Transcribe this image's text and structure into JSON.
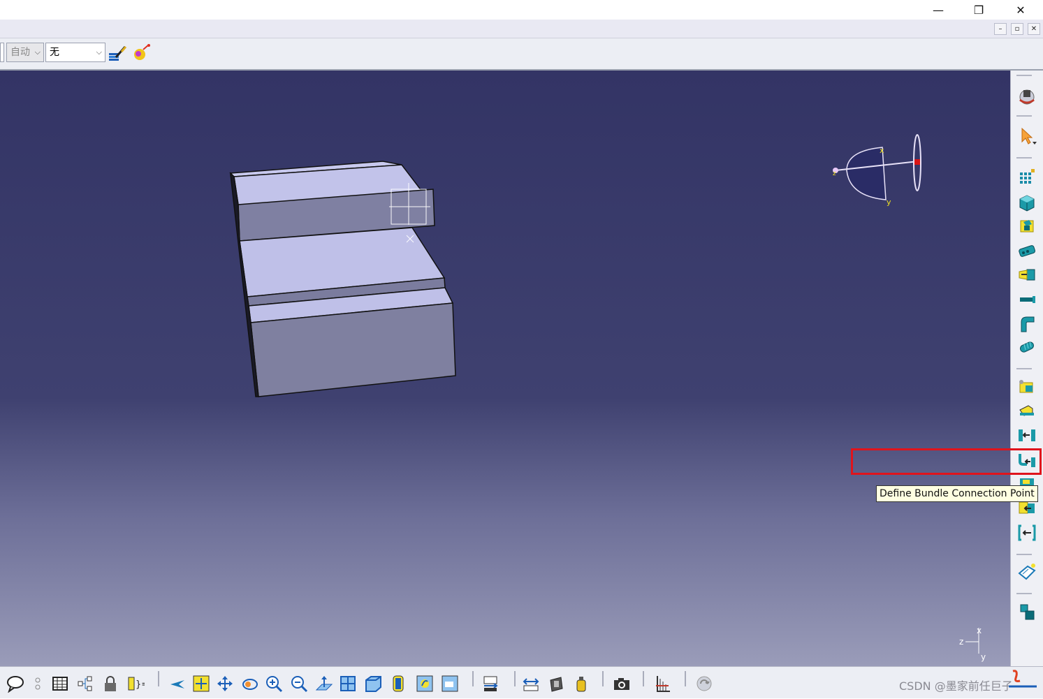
{
  "window": {
    "minimize_glyph": "—",
    "restore_glyph": "❐",
    "close_glyph": "✕",
    "mdi_minimize_glyph": "–",
    "mdi_restore_glyph": "▫",
    "mdi_close_glyph": "✕"
  },
  "toolbar": {
    "combo_layer": "自动",
    "combo_filter": "无",
    "icons": [
      "paintbrush-icon",
      "properties-painter-icon"
    ]
  },
  "tooltip": {
    "text": "Define Bundle Connection Point"
  },
  "axis_labels": {
    "compass_x": "x",
    "compass_y": "y",
    "compass_z": "z",
    "triad_x": "x",
    "triad_y": "y",
    "triad_z": "z"
  },
  "right_toolbar": {
    "icons": [
      "workbench-electrical-icon",
      "select-cursor-icon",
      "grid-icon",
      "electrical-box-icon",
      "device-icon",
      "connector-icon",
      "back-shell-icon",
      "bundle-segment-icon",
      "bent-pipe-icon",
      "cylinder-shell-icon",
      "define-cavity-icon",
      "define-connector-icon",
      "define-connection-point-icon",
      "define-bundle-connection-point-icon",
      "define-mounting-point-icon",
      "define-part-connection-icon",
      "define-internal-connection-icon",
      "part-properties-icon",
      "assembly-constraint-icon"
    ]
  },
  "bottom_toolbar": {
    "icons": [
      "speech-bubble-icon",
      "hole-icon",
      "table-icon",
      "tree-icon",
      "lock-icon",
      "formula-icon",
      "fly-mode-icon",
      "fit-all-icon",
      "pan-icon",
      "rotate-icon",
      "zoom-in-icon",
      "zoom-out-icon",
      "normal-view-icon",
      "multi-view-icon",
      "iso-view-icon",
      "shading-icon",
      "hide-show-icon",
      "swap-space-icon",
      "measure-icon",
      "measure-between-icon",
      "inertia-icon",
      "mass-icon",
      "capture-icon",
      "grid-axis-icon",
      "update-icon"
    ]
  },
  "watermark": {
    "text": "CSDN @墨家前任巨子"
  },
  "colors": {
    "viewport_top": "#333465",
    "viewport_bottom": "#9a9cb9",
    "part_face_light": "#bfc0e8",
    "part_face_dark": "#7f80a0",
    "highlight_red": "#e0141c",
    "tooltip_bg": "#ffffe1"
  }
}
